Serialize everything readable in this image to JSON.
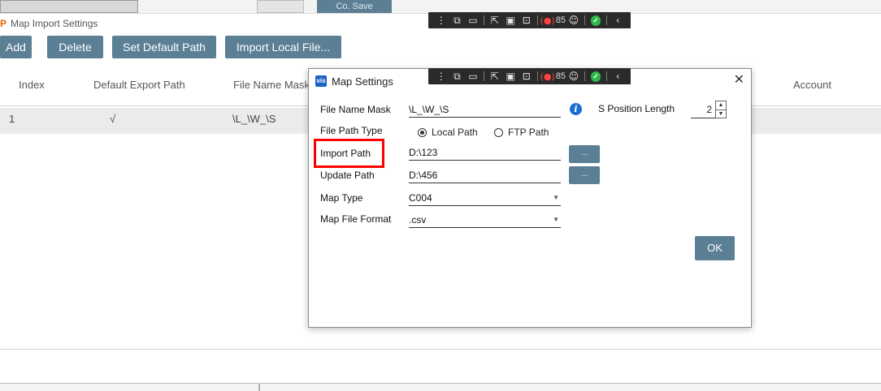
{
  "background": {
    "save_button_label": "Co. Save"
  },
  "window": {
    "title": "Map Import Settings",
    "toolbar": {
      "add": "Add",
      "delete": "Delete",
      "set_default_path": "Set Default Path",
      "import_local_file": "Import Local File..."
    },
    "table": {
      "headers": [
        "Index",
        "Default Export Path",
        "File Name Mask",
        "Account"
      ],
      "rows": [
        {
          "index": "1",
          "default": "√",
          "mask": "\\L_\\W_\\S"
        }
      ]
    }
  },
  "overlay": {
    "recording_count": "85"
  },
  "dialog": {
    "title": "Map Settings",
    "file_name_mask_label": "File Name Mask",
    "file_name_mask_value": "\\L_\\W_\\S",
    "file_path_type_label": "File Path Type",
    "local_path_option": "Local Path",
    "ftp_path_option": "FTP Path",
    "import_path_label": "Import Path",
    "import_path_value": "D:\\123",
    "update_path_label": "Update Path",
    "update_path_value": "D:\\456",
    "map_type_label": "Map Type",
    "map_type_value": "C004",
    "map_file_format_label": "Map File Format",
    "map_file_format_value": ".csv",
    "s_position_length_label": "S Position Length",
    "s_position_length_value": "2",
    "browse_label": "...",
    "ok_label": "OK",
    "close_label": "✕"
  },
  "colors": {
    "button_bg": "#5b7f95",
    "highlight": "#ff0000",
    "info": "#1b6fd1"
  }
}
